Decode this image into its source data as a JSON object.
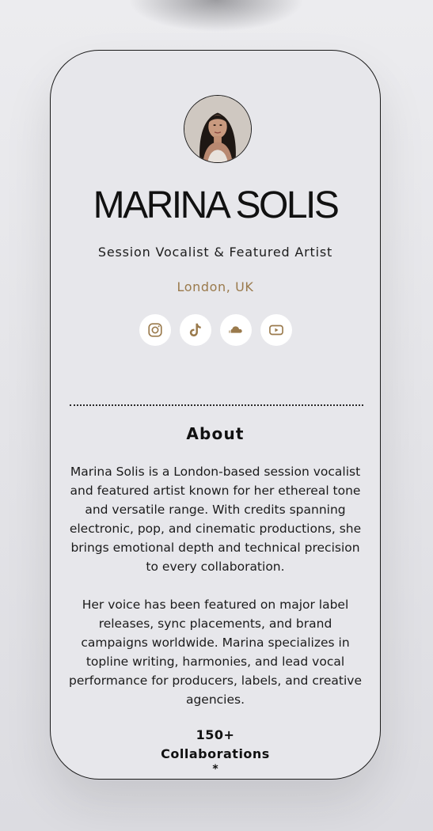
{
  "profile": {
    "name": "MARINA SOLIS",
    "role": "Session Vocalist & Featured Artist",
    "location": "London, UK"
  },
  "socials": [
    {
      "icon": "instagram-icon"
    },
    {
      "icon": "tiktok-icon"
    },
    {
      "icon": "soundcloud-icon"
    },
    {
      "icon": "youtube-icon"
    }
  ],
  "about": {
    "title": "About",
    "paragraphs": [
      "Marina Solis is a London-based session vocalist and featured artist known for her ethereal tone and versatile range. With credits spanning electronic, pop, and cinematic productions, she brings emotional depth and technical precision to every collaboration.",
      "Her voice has been featured on major label releases, sync placements, and brand campaigns worldwide. Marina specializes in topline writing, harmonies, and lead vocal performance for producers, labels, and creative agencies."
    ]
  },
  "stats": {
    "value": "150+",
    "label": "Collaborations",
    "separator": "*"
  },
  "colors": {
    "accent": "#9a7a4c",
    "card_background": "#e7e7eb",
    "icon_background": "#ffffff"
  }
}
